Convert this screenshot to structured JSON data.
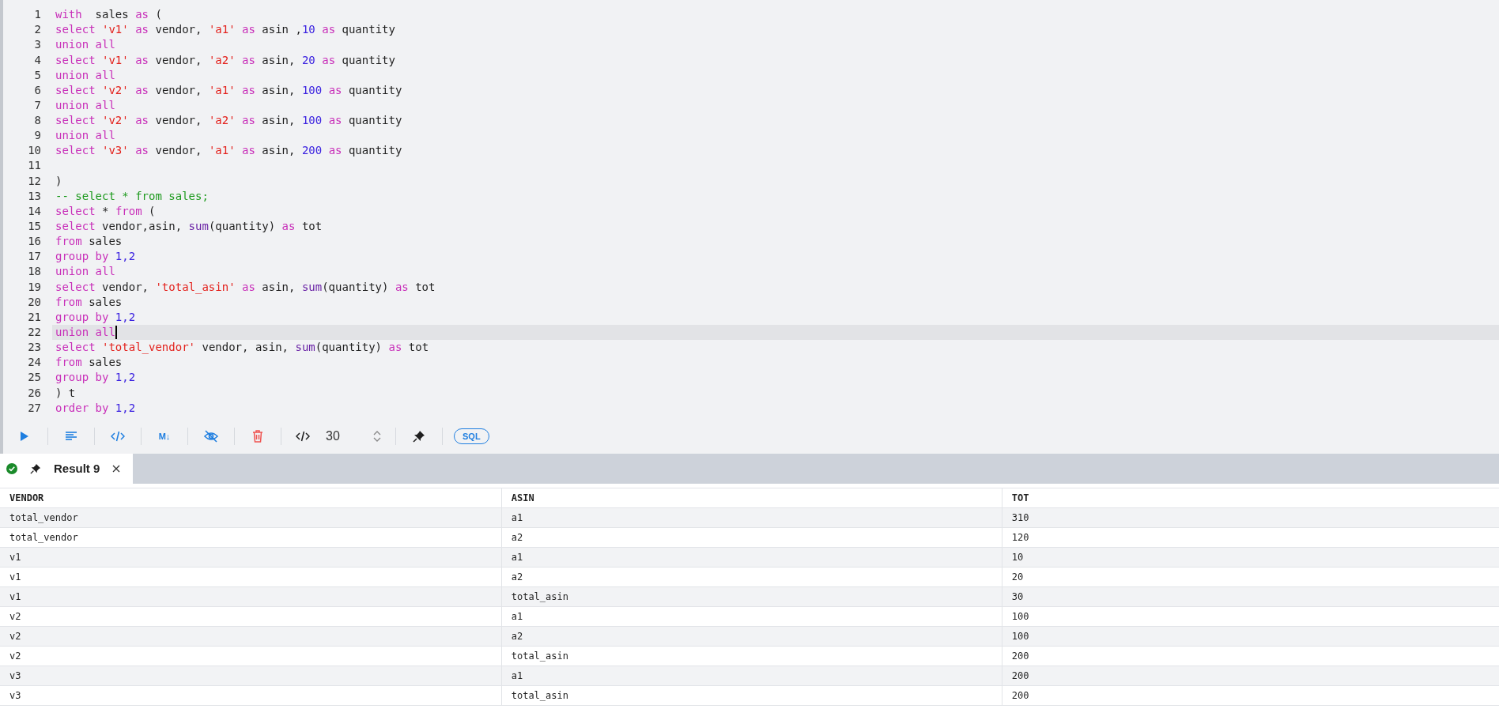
{
  "editor": {
    "lines": [
      {
        "number": "1",
        "tokens": [
          {
            "kind": "k",
            "text": "with"
          },
          {
            "kind": "p",
            "text": "  sales "
          },
          {
            "kind": "k",
            "text": "as"
          },
          {
            "kind": "p",
            "text": " ("
          }
        ],
        "active": false
      },
      {
        "number": "2",
        "tokens": [
          {
            "kind": "k",
            "text": "select "
          },
          {
            "kind": "s",
            "text": "'v1' "
          },
          {
            "kind": "k",
            "text": "as"
          },
          {
            "kind": "p",
            "text": " vendor, "
          },
          {
            "kind": "s",
            "text": "'a1' "
          },
          {
            "kind": "k",
            "text": "as"
          },
          {
            "kind": "p",
            "text": " asin ,"
          },
          {
            "kind": "n",
            "text": "10 "
          },
          {
            "kind": "k",
            "text": "as"
          },
          {
            "kind": "p",
            "text": " quantity"
          }
        ],
        "active": false
      },
      {
        "number": "3",
        "tokens": [
          {
            "kind": "k",
            "text": "union all"
          }
        ],
        "active": false
      },
      {
        "number": "4",
        "tokens": [
          {
            "kind": "k",
            "text": "select "
          },
          {
            "kind": "s",
            "text": "'v1' "
          },
          {
            "kind": "k",
            "text": "as"
          },
          {
            "kind": "p",
            "text": " vendor, "
          },
          {
            "kind": "s",
            "text": "'a2' "
          },
          {
            "kind": "k",
            "text": "as"
          },
          {
            "kind": "p",
            "text": " asin, "
          },
          {
            "kind": "n",
            "text": "20 "
          },
          {
            "kind": "k",
            "text": "as"
          },
          {
            "kind": "p",
            "text": " quantity"
          }
        ],
        "active": false
      },
      {
        "number": "5",
        "tokens": [
          {
            "kind": "k",
            "text": "union all"
          }
        ],
        "active": false
      },
      {
        "number": "6",
        "tokens": [
          {
            "kind": "k",
            "text": "select "
          },
          {
            "kind": "s",
            "text": "'v2' "
          },
          {
            "kind": "k",
            "text": "as"
          },
          {
            "kind": "p",
            "text": " vendor, "
          },
          {
            "kind": "s",
            "text": "'a1' "
          },
          {
            "kind": "k",
            "text": "as"
          },
          {
            "kind": "p",
            "text": " asin, "
          },
          {
            "kind": "n",
            "text": "100 "
          },
          {
            "kind": "k",
            "text": "as"
          },
          {
            "kind": "p",
            "text": " quantity"
          }
        ],
        "active": false
      },
      {
        "number": "7",
        "tokens": [
          {
            "kind": "k",
            "text": "union all"
          }
        ],
        "active": false
      },
      {
        "number": "8",
        "tokens": [
          {
            "kind": "k",
            "text": "select "
          },
          {
            "kind": "s",
            "text": "'v2' "
          },
          {
            "kind": "k",
            "text": "as"
          },
          {
            "kind": "p",
            "text": " vendor, "
          },
          {
            "kind": "s",
            "text": "'a2' "
          },
          {
            "kind": "k",
            "text": "as"
          },
          {
            "kind": "p",
            "text": " asin, "
          },
          {
            "kind": "n",
            "text": "100 "
          },
          {
            "kind": "k",
            "text": "as"
          },
          {
            "kind": "p",
            "text": " quantity"
          }
        ],
        "active": false
      },
      {
        "number": "9",
        "tokens": [
          {
            "kind": "k",
            "text": "union all"
          }
        ],
        "active": false
      },
      {
        "number": "10",
        "tokens": [
          {
            "kind": "k",
            "text": "select "
          },
          {
            "kind": "s",
            "text": "'v3' "
          },
          {
            "kind": "k",
            "text": "as"
          },
          {
            "kind": "p",
            "text": " vendor, "
          },
          {
            "kind": "s",
            "text": "'a1' "
          },
          {
            "kind": "k",
            "text": "as"
          },
          {
            "kind": "p",
            "text": " asin, "
          },
          {
            "kind": "n",
            "text": "200 "
          },
          {
            "kind": "k",
            "text": "as"
          },
          {
            "kind": "p",
            "text": " quantity"
          }
        ],
        "active": false
      },
      {
        "number": "11",
        "active": false
      },
      {
        "number": "12",
        "tokens": [
          {
            "kind": "p",
            "text": ")"
          }
        ],
        "active": false
      },
      {
        "number": "13",
        "tokens": [
          {
            "kind": "c",
            "text": "-- select * from sales;"
          }
        ],
        "active": false
      },
      {
        "number": "14",
        "tokens": [
          {
            "kind": "k",
            "text": "select"
          },
          {
            "kind": "p",
            "text": " * "
          },
          {
            "kind": "k",
            "text": "from"
          },
          {
            "kind": "p",
            "text": " ("
          }
        ],
        "active": false
      },
      {
        "number": "15",
        "tokens": [
          {
            "kind": "k",
            "text": "select"
          },
          {
            "kind": "p",
            "text": " vendor,asin, "
          },
          {
            "kind": "f",
            "text": "sum"
          },
          {
            "kind": "p",
            "text": "(quantity) "
          },
          {
            "kind": "k",
            "text": "as"
          },
          {
            "kind": "p",
            "text": " tot"
          }
        ],
        "active": false
      },
      {
        "number": "16",
        "tokens": [
          {
            "kind": "k",
            "text": "from"
          },
          {
            "kind": "p",
            "text": " sales"
          }
        ],
        "active": false
      },
      {
        "number": "17",
        "tokens": [
          {
            "kind": "k",
            "text": "group by "
          },
          {
            "kind": "n",
            "text": "1,2"
          }
        ],
        "active": false
      },
      {
        "number": "18",
        "tokens": [
          {
            "kind": "k",
            "text": "union all"
          }
        ],
        "active": false
      },
      {
        "number": "19",
        "tokens": [
          {
            "kind": "k",
            "text": "select"
          },
          {
            "kind": "p",
            "text": " vendor, "
          },
          {
            "kind": "s",
            "text": "'total_asin' "
          },
          {
            "kind": "k",
            "text": "as"
          },
          {
            "kind": "p",
            "text": " asin, "
          },
          {
            "kind": "f",
            "text": "sum"
          },
          {
            "kind": "p",
            "text": "(quantity) "
          },
          {
            "kind": "k",
            "text": "as"
          },
          {
            "kind": "p",
            "text": " tot"
          }
        ],
        "active": false
      },
      {
        "number": "20",
        "tokens": [
          {
            "kind": "k",
            "text": "from"
          },
          {
            "kind": "p",
            "text": " sales"
          }
        ],
        "active": false
      },
      {
        "number": "21",
        "tokens": [
          {
            "kind": "k",
            "text": "group by "
          },
          {
            "kind": "n",
            "text": "1,2"
          }
        ],
        "active": false
      },
      {
        "number": "22",
        "tokens": [
          {
            "kind": "k",
            "text": "union all"
          }
        ],
        "active": true
      },
      {
        "number": "23",
        "tokens": [
          {
            "kind": "k",
            "text": "select "
          },
          {
            "kind": "s",
            "text": "'total_vendor'"
          },
          {
            "kind": "p",
            "text": " vendor, asin, "
          },
          {
            "kind": "f",
            "text": "sum"
          },
          {
            "kind": "p",
            "text": "(quantity) "
          },
          {
            "kind": "k",
            "text": "as"
          },
          {
            "kind": "p",
            "text": " tot"
          }
        ],
        "active": false
      },
      {
        "number": "24",
        "tokens": [
          {
            "kind": "k",
            "text": "from"
          },
          {
            "kind": "p",
            "text": " sales"
          }
        ],
        "active": false
      },
      {
        "number": "25",
        "tokens": [
          {
            "kind": "k",
            "text": "group by "
          },
          {
            "kind": "n",
            "text": "1,2"
          }
        ],
        "active": false
      },
      {
        "number": "26",
        "tokens": [
          {
            "kind": "p",
            "text": ") t"
          }
        ],
        "active": false
      },
      {
        "number": "27",
        "tokens": [
          {
            "kind": "k",
            "text": "order by "
          },
          {
            "kind": "n",
            "text": "1,2"
          }
        ],
        "active": false
      }
    ]
  },
  "toolbar": [
    {
      "kind": "run"
    },
    {
      "kind": "format"
    },
    {
      "kind": "code"
    },
    {
      "kind": "markdown",
      "label": "M↓"
    },
    {
      "kind": "hide"
    },
    {
      "kind": "delete"
    },
    {
      "kind": "limit",
      "value": "30"
    },
    {
      "kind": "pin"
    },
    {
      "kind": "badge",
      "label": "SQL"
    }
  ],
  "result_tabs": [
    {
      "label": "Result 9",
      "success": true,
      "pinned": true,
      "selected": true
    }
  ],
  "table": {
    "columns": [
      "VENDOR",
      "ASIN",
      "TOT"
    ],
    "rows": [
      [
        "total_vendor",
        "a1",
        "310"
      ],
      [
        "total_vendor",
        "a2",
        "120"
      ],
      [
        "v1",
        "a1",
        "10"
      ],
      [
        "v1",
        "a2",
        "20"
      ],
      [
        "v1",
        "total_asin",
        "30"
      ],
      [
        "v2",
        "a1",
        "100"
      ],
      [
        "v2",
        "a2",
        "100"
      ],
      [
        "v2",
        "total_asin",
        "200"
      ],
      [
        "v3",
        "a1",
        "200"
      ],
      [
        "v3",
        "total_asin",
        "200"
      ]
    ]
  }
}
